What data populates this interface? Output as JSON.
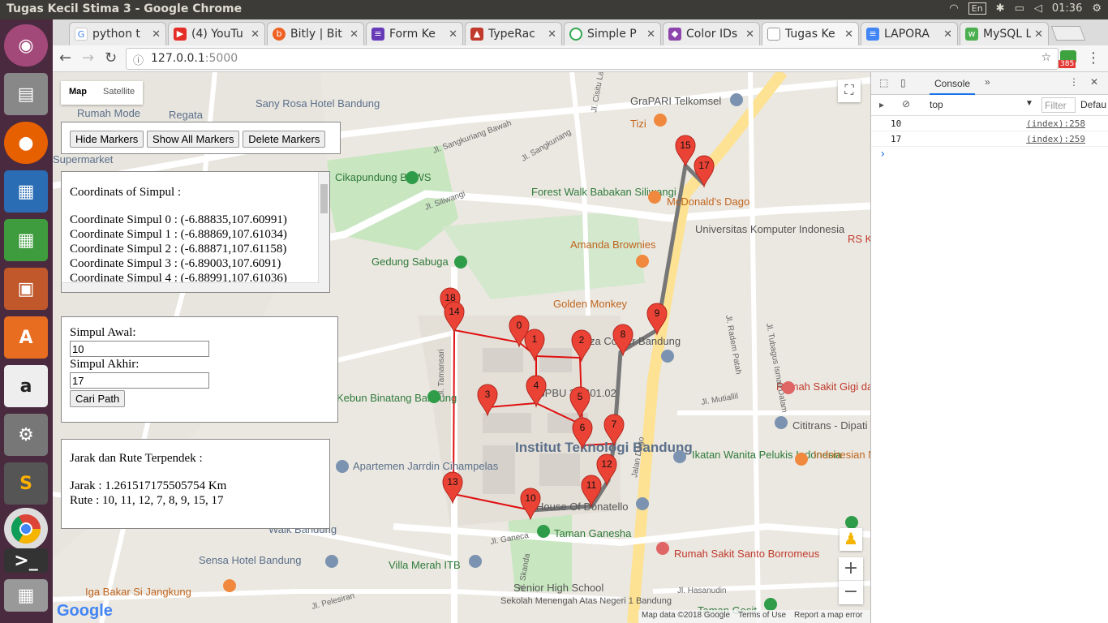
{
  "window_title": "Tugas Kecil Stima 3 - Google Chrome",
  "tray": {
    "lang": "En",
    "time": "01:36"
  },
  "tabs": [
    {
      "label": "python t",
      "icon": "google-g-icon",
      "color": "#4285f4"
    },
    {
      "label": "(4) YouTu",
      "icon": "youtube-icon",
      "color": "#e52d27"
    },
    {
      "label": "Bitly | Bit",
      "icon": "bitly-icon",
      "color": "#ee6123"
    },
    {
      "label": "Form Ke",
      "icon": "forms-icon",
      "color": "#673ab7"
    },
    {
      "label": "TypeRac",
      "icon": "typeracer-icon",
      "color": "#c0392b"
    },
    {
      "label": "Simple P",
      "icon": "chrome-ext-icon",
      "color": "#34a853"
    },
    {
      "label": "Color IDs",
      "icon": "color-icon",
      "color": "#8e44ad"
    },
    {
      "label": "Tugas Ke",
      "icon": "page-icon",
      "color": "#9e9e9e"
    },
    {
      "label": "LAPORA",
      "icon": "docs-icon",
      "color": "#4285f4"
    },
    {
      "label": "MySQL L",
      "icon": "w3-icon",
      "color": "#4caf50"
    }
  ],
  "url": {
    "host": "127.0.0.1",
    "port": ":5000"
  },
  "ext_badge": "385",
  "map": {
    "type_map": "Map",
    "type_satellite": "Satellite",
    "buttons": {
      "hide": "Hide Markers",
      "show": "Show All Markers",
      "delete": "Delete Markers"
    },
    "coords_title": "Coordinats of Simpul :",
    "coords": [
      "Coordinate Simpul 0 : (-6.88835,107.60991)",
      "Coordinate Simpul 1 : (-6.88869,107.61034)",
      "Coordinate Simpul 2 : (-6.88871,107.61158)",
      "Coordinate Simpul 3 : (-6.89003,107.6091)",
      "Coordinate Simpul 4 : (-6.88991,107.61036)"
    ],
    "awal_label": "Simpul Awal:",
    "awal_value": "10",
    "akhir_label": "Simpul Akhir:",
    "akhir_value": "17",
    "cari_label": "Cari Path",
    "result_title": "Jarak dan Rute Terpendek :",
    "jarak": "Jarak : 1.261517175505754 Km",
    "rute": "Rute : 10, 11, 12, 7, 8, 9, 15, 17",
    "attribution": "Map data ©2018 Google",
    "terms": "Terms of Use",
    "report": "Report a map error",
    "google": "Google",
    "zoom_in": "+",
    "zoom_out": "−",
    "places": [
      "Rumah Mode",
      "Regata",
      "Sany Rosa Hotel Bandung",
      "GraPARI Telkomsel",
      "Tizi",
      "Supermarket",
      "Cikapundung BBWS",
      "Forest Walk Babakan Siliwangi",
      "McDonald's Dago",
      "Universitas Komputer Indonesia",
      "Amanda Brownies",
      "Gedung Sabuga",
      "Golden Monkey",
      "Pizza Comer Bandung",
      "Kebun Binatang Bandung",
      "SPBU 34.401.02",
      "Institut Teknologi Bandung",
      "Apartemen Jarrdin Cihampelas",
      "Ikatan Wanita Pelukis Indonesia",
      "Indonesian Nasi Goreng",
      "Rumah Sakit Gigi dan Mulut Unpad",
      "Cititrans - Dipati",
      "House Of Donatello",
      "Taman Ganesha",
      "Walk Bandung",
      "Sensa Hotel Bandung",
      "Villa Merah ITB",
      "Rumah Sakit Santo Borromeus",
      "Iga Bakar Si Jangkung",
      "Senior High School",
      "Sekolah Menengah Atas Negeri 1 Bandung",
      "Taman Gesit",
      "RS K"
    ],
    "roads": [
      "Jl. Siliwangi",
      "Jalan Dago",
      "Jl. Tamansari",
      "Jl. Ganeca",
      "Jl. Pelesiran",
      "Jl. Hasanudin",
      "Jl. Tubagus Ismail Dalam",
      "Jl. Radem Patah",
      "Jl. Sangkuriang",
      "Jl. Cisitu Lama",
      "Jl. Skanda",
      "Jl. Mutiallil",
      "Jl. Sangkuriang Bawah"
    ],
    "markers": [
      {
        "label": "0"
      },
      {
        "label": "1"
      },
      {
        "label": "2"
      },
      {
        "label": "3"
      },
      {
        "label": "4"
      },
      {
        "label": "5"
      },
      {
        "label": "6"
      },
      {
        "label": "7"
      },
      {
        "label": "8"
      },
      {
        "label": "9"
      },
      {
        "label": "10"
      },
      {
        "label": "11"
      },
      {
        "label": "12"
      },
      {
        "label": "13"
      },
      {
        "label": "14"
      },
      {
        "label": "15"
      },
      {
        "label": "17"
      },
      {
        "label": "18"
      }
    ]
  },
  "devtools": {
    "tab": "Console",
    "context": "top",
    "filter_placeholder": "Filter",
    "levels": "Defau",
    "logs": [
      {
        "value": "10",
        "source": "(index):258"
      },
      {
        "value": "17",
        "source": "(index):259"
      }
    ],
    "prompt": "›"
  }
}
